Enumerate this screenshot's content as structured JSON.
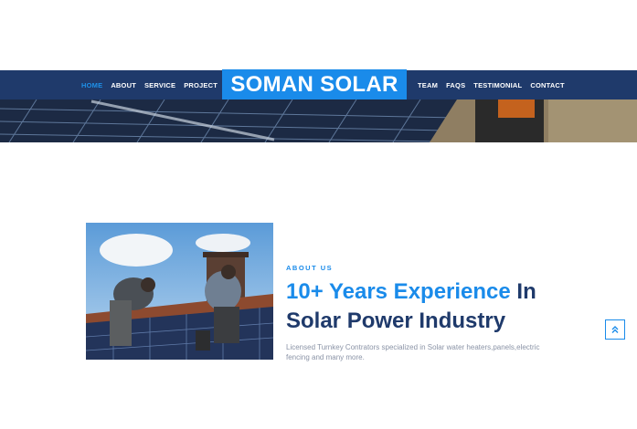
{
  "nav": {
    "left": [
      {
        "label": "HOME",
        "active": true
      },
      {
        "label": "ABOUT"
      },
      {
        "label": "SERVICE"
      },
      {
        "label": "PROJECT"
      }
    ],
    "right": [
      {
        "label": "TEAM"
      },
      {
        "label": "FAQS"
      },
      {
        "label": "TESTIMONIAL"
      },
      {
        "label": "CONTACT"
      }
    ],
    "brand": "SOMAN SOLAR"
  },
  "about": {
    "kicker": "ABOUT US",
    "title_accent": "10+ Years Experience",
    "title_rest": " In Solar Power Industry",
    "description": "Licensed Turnkey Contrators specialized in Solar water heaters,panels,electric fencing and many more."
  },
  "icons": {
    "scroll_top": "double-chevron-up-icon"
  },
  "colors": {
    "navbar": "#1f3a6b",
    "accent": "#1a8bea",
    "heading": "#1f3a6b",
    "body_text": "#8a93a6"
  }
}
